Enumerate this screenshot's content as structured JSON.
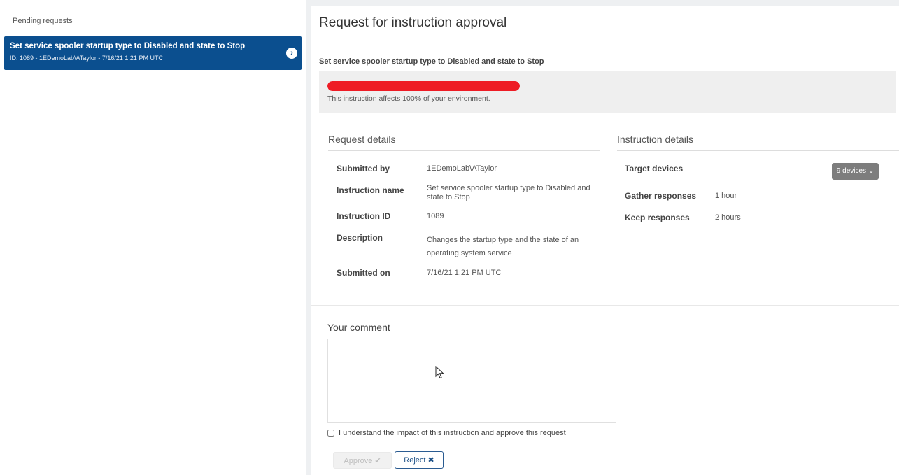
{
  "sidebar": {
    "header": "Pending requests",
    "items": [
      {
        "title": "Set service spooler startup type to Disabled and state to Stop",
        "meta": "ID: 1089 - 1EDemoLab\\ATaylor - 7/16/21 1:21 PM UTC",
        "chevron": "›"
      }
    ]
  },
  "main": {
    "title": "Request for instruction approval",
    "instruction_name": "Set service spooler startup type to Disabled and state to Stop",
    "impact": {
      "percent": 100,
      "text": "This instruction affects 100% of your environment.",
      "bar_color": "#ee1c25"
    },
    "request_details": {
      "heading": "Request details",
      "rows": [
        {
          "label": "Submitted by",
          "value": "1EDemoLab\\ATaylor"
        },
        {
          "label": "Instruction name",
          "value": "Set service spooler startup type to Disabled and state to Stop"
        },
        {
          "label": "Instruction ID",
          "value": "1089"
        },
        {
          "label": "Description",
          "value": "Changes the startup type and the state of an operating system service"
        },
        {
          "label": "Submitted on",
          "value": "7/16/21 1:21 PM UTC"
        }
      ]
    },
    "instruction_details": {
      "heading": "Instruction details",
      "target_label": "Target devices",
      "devices_button": "9 devices ⌄",
      "rows": [
        {
          "label": "Gather responses",
          "value": "1 hour"
        },
        {
          "label": "Keep responses",
          "value": "2 hours"
        }
      ]
    },
    "comment": {
      "label": "Your comment",
      "value": ""
    },
    "approve_checkbox_label": "I understand the impact of this instruction and approve this request",
    "buttons": {
      "approve": "Approve ✔",
      "reject": "Reject ✖"
    }
  },
  "colors": {
    "selected_item_bg": "#0b4f8f",
    "impact_bar": "#ee1c25",
    "reject_border": "#2a5b91"
  }
}
